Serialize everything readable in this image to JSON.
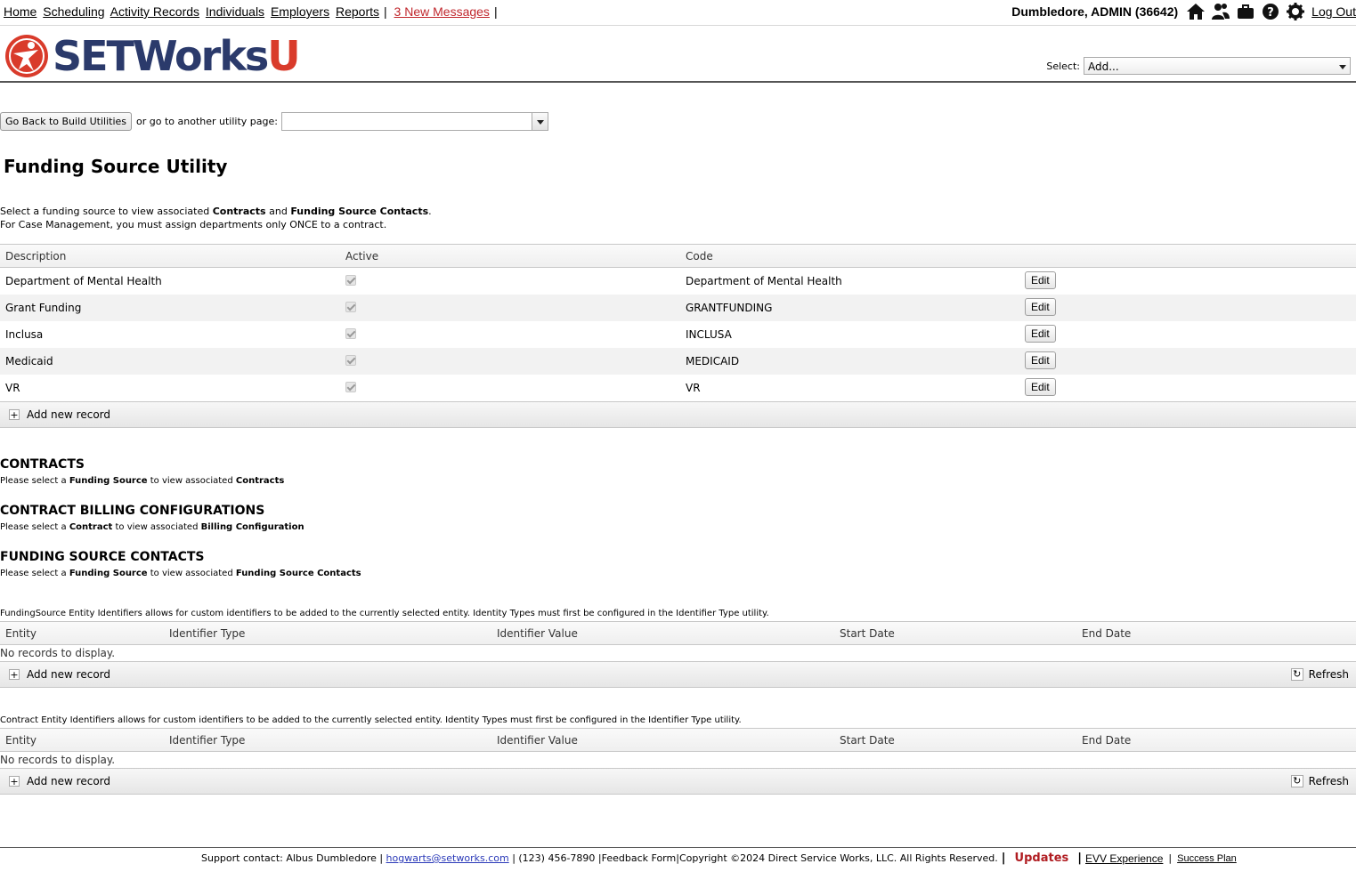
{
  "nav": {
    "items": [
      "Home",
      "Scheduling",
      "Activity Records",
      "Individuals",
      "Employers",
      "Reports"
    ],
    "messages": "3 New Messages"
  },
  "user": {
    "name": "Dumbledore, ADMIN (36642)",
    "logout": "Log Out",
    "icons": [
      "home-icon",
      "people-icon",
      "briefcase-icon",
      "help-icon",
      "gear-icon"
    ]
  },
  "logo": {
    "text": "SETWorks",
    "suffix": "U",
    "color_primary": "#2b3a6b",
    "color_accent": "#d93b2b"
  },
  "select": {
    "label": "Select:",
    "value": "Add..."
  },
  "util_nav": {
    "back_button": "Go Back to Build Utilities",
    "or_text": "or go to another utility page:",
    "page_value": ""
  },
  "page": {
    "title": "Funding Source Utility",
    "intro_line1_parts": [
      "Select a funding source to view associated ",
      "Contracts",
      " and ",
      "Funding Source Contacts",
      "."
    ],
    "intro_line2": "For Case Management, you must assign departments only ONCE to a contract."
  },
  "funding_grid": {
    "columns": [
      "Description",
      "Active",
      "Code"
    ],
    "rows": [
      {
        "description": "Department of Mental Health",
        "active": true,
        "code": "Department of Mental Health",
        "edit": "Edit"
      },
      {
        "description": "Grant Funding",
        "active": true,
        "code": "GRANTFUNDING",
        "edit": "Edit"
      },
      {
        "description": "Inclusa",
        "active": true,
        "code": "INCLUSA",
        "edit": "Edit"
      },
      {
        "description": "Medicaid",
        "active": true,
        "code": "MEDICAID",
        "edit": "Edit"
      },
      {
        "description": "VR",
        "active": true,
        "code": "VR",
        "edit": "Edit"
      }
    ],
    "add_label": "Add new record"
  },
  "sections": {
    "contracts": {
      "title": "CONTRACTS",
      "parts": [
        "Please select a ",
        "Funding Source",
        " to view associated ",
        "Contracts"
      ]
    },
    "billing": {
      "title": "CONTRACT BILLING CONFIGURATIONS",
      "parts": [
        "Please select a ",
        "Contract",
        " to view associated ",
        "Billing Configuration"
      ]
    },
    "contacts": {
      "title": "FUNDING SOURCE CONTACTS",
      "parts": [
        "Please select a ",
        "Funding Source",
        " to view associated ",
        "Funding Source Contacts"
      ]
    }
  },
  "fs_identifiers": {
    "note": "FundingSource Entity Identifiers allows for custom identifiers to be added to the currently selected entity. Identity Types must first be configured in the Identifier Type utility.",
    "columns": [
      "Entity",
      "Identifier Type",
      "Identifier Value",
      "Start Date",
      "End Date"
    ],
    "empty": "No records to display.",
    "add_label": "Add new record",
    "refresh_label": "Refresh"
  },
  "contract_identifiers": {
    "note": "Contract Entity Identifiers allows for custom identifiers to be added to the currently selected entity. Identity Types must first be configured in the Identifier Type utility.",
    "columns": [
      "Entity",
      "Identifier Type",
      "Identifier Value",
      "Start Date",
      "End Date"
    ],
    "empty": "No records to display.",
    "add_label": "Add new record",
    "refresh_label": "Refresh"
  },
  "footer": {
    "support": "Support contact: Albus Dumbledore |",
    "email": "hogwarts@setworks.com",
    "phone": "| (123) 456-7890 |",
    "feedback": "Feedback Form",
    "copyright": "|Copyright ©2024 Direct Service Works, LLC. All Rights Reserved.",
    "updates": "Updates",
    "evv": "EVV Experience",
    "success": "Success Plan"
  }
}
